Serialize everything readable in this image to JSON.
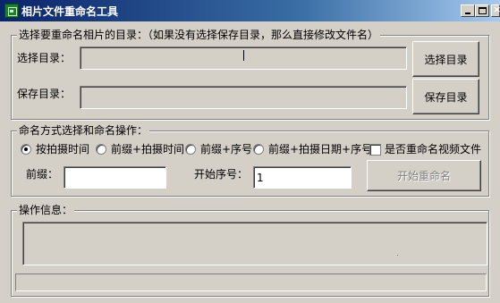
{
  "window": {
    "title": "相片文件重命名工具",
    "minimize_label": "_",
    "close_label": "×"
  },
  "directory_group": {
    "legend": "选择要重命名相片的目录：（如果没有选择保存目录，那么直接修改文件名）",
    "select_dir_label": "选择目录：",
    "select_dir_value": "",
    "select_dir_button": "选择目录",
    "save_dir_label": "保存目录：",
    "save_dir_value": "",
    "save_dir_button": "保存目录"
  },
  "naming_group": {
    "legend": "命名方式选择和命名操作：",
    "options": [
      {
        "label": "按拍摄时间",
        "checked": true
      },
      {
        "label": "前缀+拍摄时间",
        "checked": false
      },
      {
        "label": "前缀+序号",
        "checked": false
      },
      {
        "label": "前缀+拍摄日期+序号",
        "checked": false
      }
    ],
    "rename_video_label": "是否重命名视频文件",
    "rename_video_checked": false,
    "prefix_label": "前缀：",
    "prefix_value": "",
    "start_number_label": "开始序号：",
    "start_number_value": "1",
    "start_button": "开始重命名"
  },
  "info_group": {
    "legend": "操作信息：",
    "message": ""
  }
}
